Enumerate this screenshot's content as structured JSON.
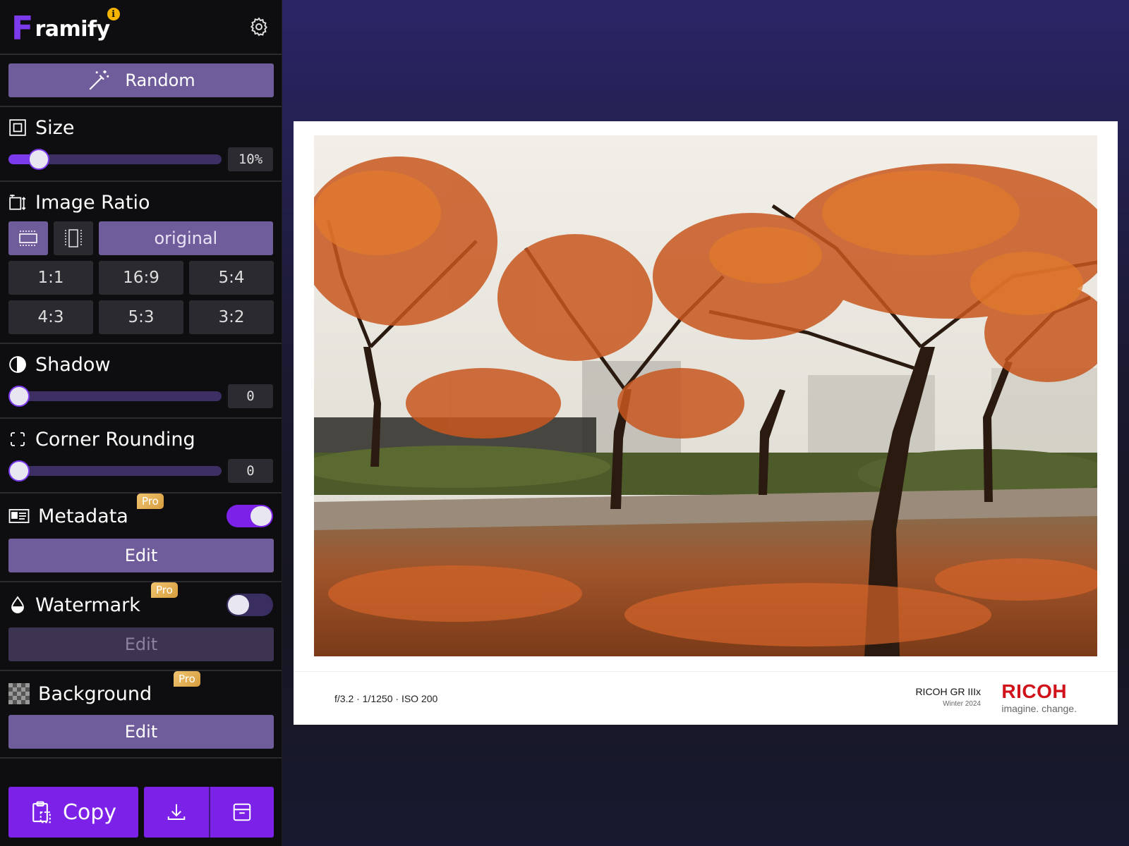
{
  "app": {
    "logo_letter": "F",
    "logo_rest": "ramify",
    "info_badge": "i"
  },
  "random_button": {
    "label": "Random"
  },
  "size": {
    "title": "Size",
    "value_text": "10%",
    "value": 10,
    "max": 100
  },
  "image_ratio": {
    "title": "Image Ratio",
    "original_label": "original",
    "ratios": [
      "1:1",
      "16:9",
      "5:4",
      "4:3",
      "5:3",
      "3:2"
    ]
  },
  "shadow": {
    "title": "Shadow",
    "value_text": "0",
    "value": 0
  },
  "corner_rounding": {
    "title": "Corner Rounding",
    "value_text": "0",
    "value": 0
  },
  "metadata": {
    "title": "Metadata",
    "pro": "Pro",
    "enabled": true,
    "edit_label": "Edit"
  },
  "watermark": {
    "title": "Watermark",
    "pro": "Pro",
    "enabled": false,
    "edit_label": "Edit"
  },
  "background": {
    "title": "Background",
    "pro": "Pro",
    "edit_label": "Edit"
  },
  "actions": {
    "copy_label": "Copy"
  },
  "preview": {
    "exif": "f/3.2 · 1/1250 · ISO 200",
    "camera_model": "RICOH GR IIIx",
    "camera_sub": "Winter 2024",
    "brand_name": "RICOH",
    "brand_tagline": "imagine. change."
  },
  "colors": {
    "accent": "#7c3aed",
    "button": "#6f5c9a",
    "pro_badge": "#e0aa50",
    "brand_red": "#d0121b"
  }
}
